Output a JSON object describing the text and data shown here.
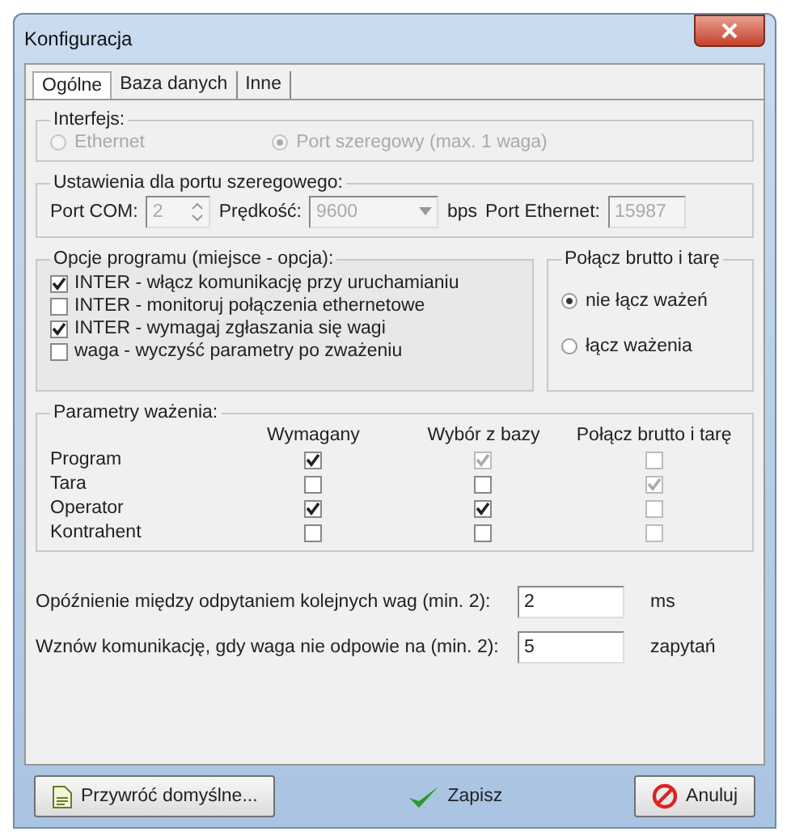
{
  "window": {
    "title": "Konfiguracja"
  },
  "tabs": [
    {
      "label": "Ogólne",
      "selected": true
    },
    {
      "label": "Baza danych",
      "selected": false
    },
    {
      "label": "Inne",
      "selected": false
    }
  ],
  "interface": {
    "title": "Interfejs:",
    "options": [
      {
        "label": "Ethernet",
        "selected": false,
        "disabled": true
      },
      {
        "label": "Port szeregowy (max. 1 waga)",
        "selected": true,
        "disabled": true
      }
    ]
  },
  "serial": {
    "title": "Ustawienia dla portu szeregowego:",
    "com_label": "Port COM:",
    "com_value": "2",
    "speed_label": "Prędkość:",
    "speed_value": "9600",
    "speed_unit": "bps",
    "eth_label": "Port Ethernet:",
    "eth_value": "15987"
  },
  "options": {
    "title": "Opcje programu (miejsce - opcja):",
    "items": [
      {
        "label": "INTER - włącz komunikację przy uruchamianiu",
        "checked": true
      },
      {
        "label": "INTER - monitoruj połączenia ethernetowe",
        "checked": false
      },
      {
        "label": "INTER - wymagaj zgłaszania się wagi",
        "checked": true
      },
      {
        "label": "waga - wyczyść parametry po zważeniu",
        "checked": false
      }
    ]
  },
  "combine": {
    "title": "Połącz brutto i tarę",
    "options": [
      {
        "label": "nie łącz ważeń",
        "selected": true
      },
      {
        "label": "łącz ważenia",
        "selected": false
      }
    ]
  },
  "params": {
    "title": "Parametry ważenia:",
    "columns": [
      "Wymagany",
      "Wybór z bazy",
      "Połącz brutto i tarę"
    ],
    "rows": [
      {
        "label": "Program",
        "cells": [
          {
            "checked": true,
            "disabled": false
          },
          {
            "checked": true,
            "disabled": true
          },
          {
            "checked": false,
            "disabled": true
          }
        ]
      },
      {
        "label": "Tara",
        "cells": [
          {
            "checked": false,
            "disabled": false
          },
          {
            "checked": false,
            "disabled": false
          },
          {
            "checked": true,
            "disabled": true
          }
        ]
      },
      {
        "label": "Operator",
        "cells": [
          {
            "checked": true,
            "disabled": false
          },
          {
            "checked": true,
            "disabled": false
          },
          {
            "checked": false,
            "disabled": true
          }
        ]
      },
      {
        "label": "Kontrahent",
        "cells": [
          {
            "checked": false,
            "disabled": false
          },
          {
            "checked": false,
            "disabled": false
          },
          {
            "checked": false,
            "disabled": true
          }
        ]
      }
    ]
  },
  "timing": [
    {
      "label": "Opóźnienie między odpytaniem kolejnych wag (min. 2):",
      "value": "2",
      "unit": "ms"
    },
    {
      "label": "Wznów komunikację, gdy waga nie odpowie na (min. 2):",
      "value": "5",
      "unit": "zapytań"
    }
  ],
  "buttons": [
    {
      "label": "Przywróć domyślne...",
      "kind": "restore"
    },
    {
      "label": "Zapisz",
      "kind": "save"
    },
    {
      "label": "Anuluj",
      "kind": "cancel"
    }
  ]
}
